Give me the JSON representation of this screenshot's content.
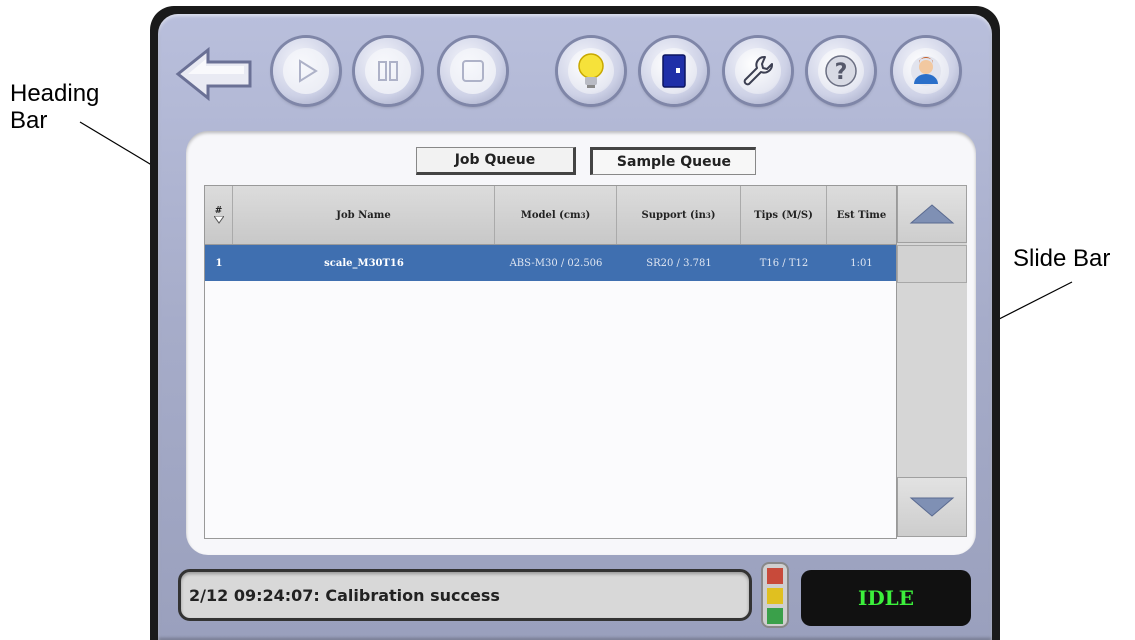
{
  "callouts": {
    "heading_bar": "Heading\nBar",
    "slide_bar": "Slide Bar"
  },
  "toolbar": {
    "buttons": [
      {
        "name": "back",
        "icon": "back-arrow-icon"
      },
      {
        "name": "play",
        "icon": "play-icon",
        "enabled": false
      },
      {
        "name": "pause",
        "icon": "pause-icon",
        "enabled": false
      },
      {
        "name": "stop",
        "icon": "stop-icon",
        "enabled": false
      },
      {
        "name": "light",
        "icon": "light-bulb-icon"
      },
      {
        "name": "door",
        "icon": "door-icon"
      },
      {
        "name": "maintenance",
        "icon": "wrench-icon"
      },
      {
        "name": "help",
        "icon": "help-icon"
      },
      {
        "name": "user",
        "icon": "user-icon"
      }
    ]
  },
  "tabs": [
    {
      "label": "Job Queue",
      "active": false
    },
    {
      "label": "Sample Queue",
      "active": true
    }
  ],
  "table": {
    "headers": {
      "index": "#",
      "job_name": "Job Name",
      "model": "Model (cm",
      "model_sup": "3",
      "model_close": ")",
      "support": "Support (in",
      "support_sup": "3",
      "support_close": ")",
      "tips": "Tips (M/S)",
      "est_time": "Est Time"
    },
    "rows": [
      {
        "index": "1",
        "job_name": "scale_M30T16",
        "model": "ABS-M30 / 02.506",
        "support": "SR20 / 3.781",
        "tips": "T16 / T12",
        "est_time": "1:01",
        "selected": true
      }
    ]
  },
  "status": {
    "message": "2/12 09:24:07: Calibration success",
    "state": "IDLE"
  },
  "colors": {
    "selected_row": "#3f6fb0",
    "idle_text": "#3cf03c",
    "bezel": "#a6acc9"
  }
}
